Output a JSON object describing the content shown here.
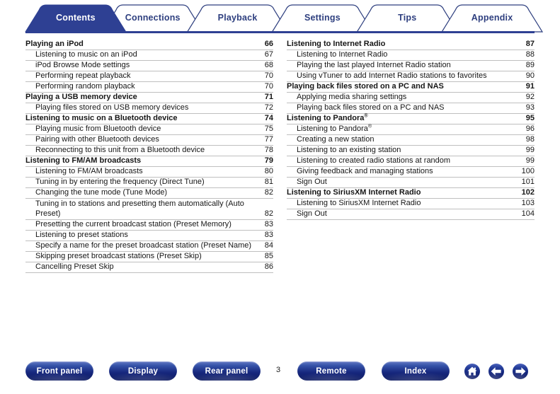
{
  "tabs": [
    {
      "label": "Contents",
      "active": true
    },
    {
      "label": "Connections",
      "active": false
    },
    {
      "label": "Playback",
      "active": false
    },
    {
      "label": "Settings",
      "active": false
    },
    {
      "label": "Tips",
      "active": false
    },
    {
      "label": "Appendix",
      "active": false
    }
  ],
  "colors": {
    "accent": "#2e3f7f",
    "active_tab_fill": "#2e4093",
    "tab_border": "#2e3f7f",
    "rule": "#bfbfbf",
    "button_navy": "#16277d",
    "button_light": "#6379c4",
    "text": "#161616"
  },
  "toc": {
    "left_column": [
      {
        "title": "Playing an iPod",
        "page": "66",
        "level": 1
      },
      {
        "title": "Listening to music on an iPod",
        "page": "67",
        "level": 2
      },
      {
        "title": "iPod Browse Mode settings",
        "page": "68",
        "level": 2
      },
      {
        "title": "Performing repeat playback",
        "page": "70",
        "level": 2
      },
      {
        "title": "Performing random playback",
        "page": "70",
        "level": 2
      },
      {
        "title": "Playing a USB memory device",
        "page": "71",
        "level": 1
      },
      {
        "title": "Playing files stored on USB memory devices",
        "page": "72",
        "level": 2
      },
      {
        "title": "Listening to music on a Bluetooth device",
        "page": "74",
        "level": 1
      },
      {
        "title": "Playing music from Bluetooth device",
        "page": "75",
        "level": 2
      },
      {
        "title": "Pairing with other Bluetooth devices",
        "page": "77",
        "level": 2
      },
      {
        "title": "Reconnecting to this unit from a Bluetooth device",
        "page": "78",
        "level": 2
      },
      {
        "title": "Listening to FM/AM broadcasts",
        "page": "79",
        "level": 1
      },
      {
        "title": "Listening to FM/AM broadcasts",
        "page": "80",
        "level": 2
      },
      {
        "title": "Tuning in by entering the frequency (Direct Tune)",
        "page": "81",
        "level": 2
      },
      {
        "title": "Changing the tune mode (Tune Mode)",
        "page": "82",
        "level": 2
      },
      {
        "title": "Tuning in to stations and presetting them automatically (Auto Preset)",
        "page": "82",
        "level": 2,
        "two_line": true
      },
      {
        "title": "Presetting the current broadcast station (Preset Memory)",
        "page": "83",
        "level": 2
      },
      {
        "title": "Listening to preset stations",
        "page": "83",
        "level": 2
      },
      {
        "title": "Specify a name for the preset broadcast station (Preset Name)",
        "page": "84",
        "level": 2
      },
      {
        "title": "Skipping preset broadcast stations (Preset Skip)",
        "page": "85",
        "level": 2
      },
      {
        "title": "Cancelling Preset Skip",
        "page": "86",
        "level": 2
      }
    ],
    "right_column": [
      {
        "title": "Listening to Internet Radio",
        "page": "87",
        "level": 1
      },
      {
        "title": "Listening to Internet Radio",
        "page": "88",
        "level": 2
      },
      {
        "title": "Playing the last played Internet Radio station",
        "page": "89",
        "level": 2
      },
      {
        "title": "Using vTuner to add Internet Radio stations to favorites",
        "page": "90",
        "level": 2
      },
      {
        "title": "Playing back files stored on a PC and NAS",
        "page": "91",
        "level": 1
      },
      {
        "title": "Applying media sharing settings",
        "page": "92",
        "level": 2
      },
      {
        "title": "Playing back files stored on a PC and NAS",
        "page": "93",
        "level": 2
      },
      {
        "title": "Listening to Pandora",
        "page": "95",
        "level": 1,
        "registered": true
      },
      {
        "title": "Listening to Pandora",
        "page": "96",
        "level": 2,
        "registered": true
      },
      {
        "title": "Creating a new station",
        "page": "98",
        "level": 2
      },
      {
        "title": "Listening to an existing station",
        "page": "99",
        "level": 2
      },
      {
        "title": "Listening to created radio stations at random",
        "page": "99",
        "level": 2
      },
      {
        "title": "Giving feedback and managing stations",
        "page": "100",
        "level": 2
      },
      {
        "title": "Sign Out",
        "page": "101",
        "level": 2
      },
      {
        "title": "Listening to SiriusXM Internet Radio",
        "page": "102",
        "level": 1
      },
      {
        "title": "Listening to SiriusXM Internet Radio",
        "page": "103",
        "level": 2
      },
      {
        "title": "Sign Out",
        "page": "104",
        "level": 2
      }
    ]
  },
  "footer": {
    "buttons": [
      {
        "id": "front",
        "label": "Front panel"
      },
      {
        "id": "disp",
        "label": "Display"
      },
      {
        "id": "rear",
        "label": "Rear panel"
      },
      {
        "id": "remote",
        "label": "Remote"
      },
      {
        "id": "index",
        "label": "Index"
      }
    ],
    "page_number": "3",
    "icons": [
      {
        "id": "home",
        "name": "home-icon"
      },
      {
        "id": "back",
        "name": "arrow-left-icon"
      },
      {
        "id": "next",
        "name": "arrow-right-icon"
      }
    ]
  }
}
